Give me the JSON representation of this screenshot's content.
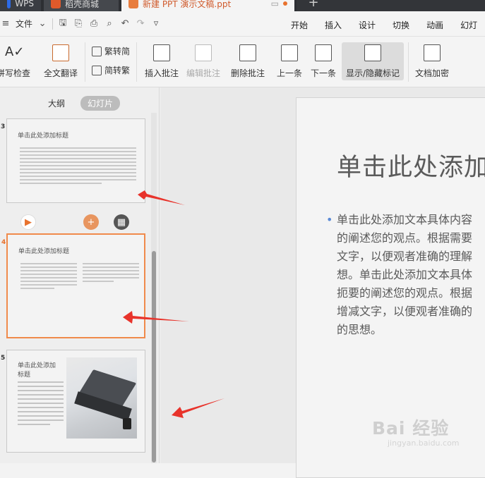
{
  "tabs": {
    "wps": "WPS",
    "store": "稻壳商城",
    "doc": "新建 PPT 演示文稿.ppt"
  },
  "menubar": {
    "file_label": "文件",
    "tabs": [
      "开始",
      "插入",
      "设计",
      "切换",
      "动画",
      "幻灯"
    ]
  },
  "ribbon": {
    "spell_check": "拼写检查",
    "translate": "全文翻译",
    "trad_to_simp": "繁转简",
    "simp_to_trad": "简转繁",
    "insert_comment": "插入批注",
    "edit_comment": "编辑批注",
    "delete_comment": "删除批注",
    "prev_item": "上一条",
    "next_item": "下一条",
    "show_hide_marks": "显示/隐藏标记",
    "doc_encrypt": "文档加密"
  },
  "panel": {
    "outline_tab": "大纲",
    "slides_tab": "幻灯片",
    "slides": [
      {
        "number": "3",
        "title": "单击此处添加标题"
      },
      {
        "number": "4",
        "title": "单击此处添加标题"
      },
      {
        "number": "5",
        "title": "单击此处添加标题"
      }
    ]
  },
  "slide": {
    "title": "单击此处添加",
    "body_lines": [
      "单击此处添加文本具体内容",
      "的阐述您的观点。根据需要",
      "文字，以便观者准确的理解",
      "想。单击此处添加文本具体",
      "扼要的阐述您的观点。根据",
      "增减文字，以便观者准确的",
      "的思想。"
    ]
  },
  "watermark": {
    "main": "Bai 经验",
    "sub": "jingyan.baidu.com"
  },
  "colors": {
    "accent": "#e8722e",
    "annotation_arrow": "#e8332b"
  }
}
